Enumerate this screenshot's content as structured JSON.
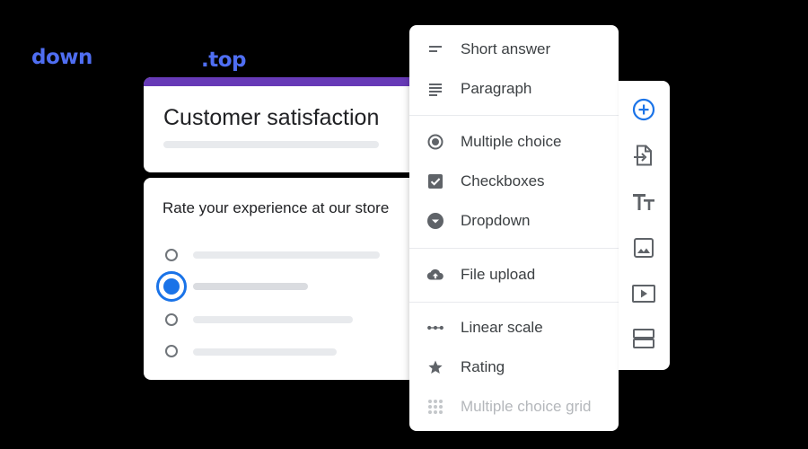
{
  "wordmark": {
    "left": "down",
    "right": ".top"
  },
  "form": {
    "title": "Customer satisfaction",
    "question": "Rate your experience at our store"
  },
  "question_types": {
    "items": [
      {
        "label": "Short answer",
        "icon": "short-text-icon"
      },
      {
        "label": "Paragraph",
        "icon": "paragraph-icon"
      },
      {
        "label": "Multiple choice",
        "icon": "radio-button-icon"
      },
      {
        "label": "Checkboxes",
        "icon": "checkbox-icon"
      },
      {
        "label": "Dropdown",
        "icon": "dropdown-icon"
      },
      {
        "label": "File upload",
        "icon": "cloud-upload-icon"
      },
      {
        "label": "Linear scale",
        "icon": "linear-scale-icon"
      },
      {
        "label": "Rating",
        "icon": "star-icon"
      },
      {
        "label": "Multiple choice grid",
        "icon": "grid-icon"
      }
    ]
  },
  "toolbar": {
    "items": [
      {
        "icon": "add-question-icon",
        "name": "add-question-button"
      },
      {
        "icon": "import-questions-icon",
        "name": "import-questions-button"
      },
      {
        "icon": "title-text-icon",
        "name": "add-title-button"
      },
      {
        "icon": "image-icon",
        "name": "add-image-button"
      },
      {
        "icon": "video-icon",
        "name": "add-video-button"
      },
      {
        "icon": "section-icon",
        "name": "add-section-button"
      }
    ]
  },
  "colors": {
    "accent": "#673ab7",
    "primary": "#1a73e8",
    "wordmark": "#4f6ef2",
    "icon": "#5f6368"
  }
}
